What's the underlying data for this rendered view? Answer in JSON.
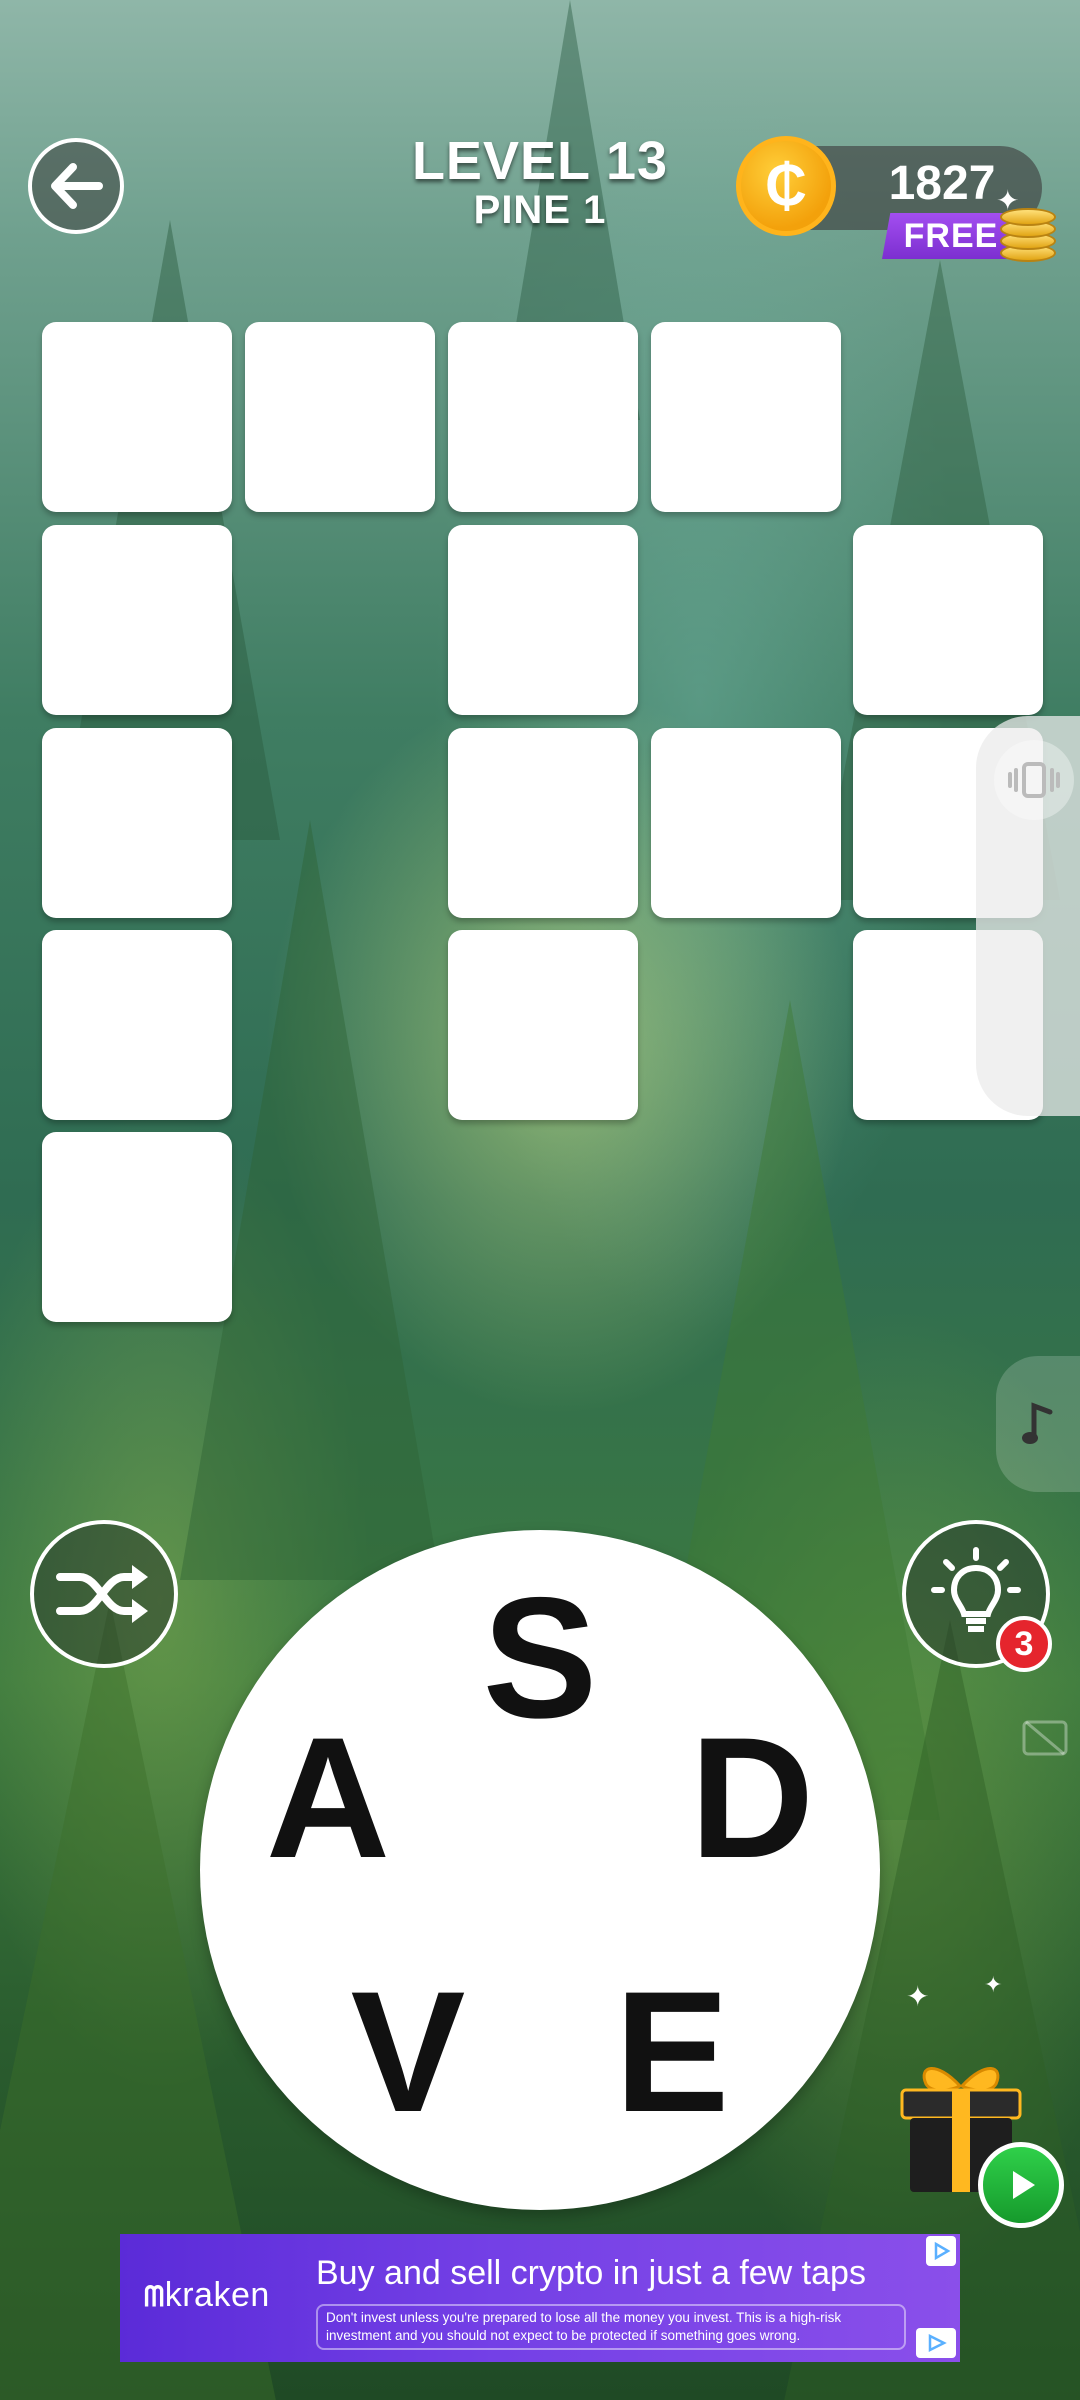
{
  "header": {
    "level_title": "LEVEL 13",
    "level_subtitle": "PINE 1",
    "coins": "1827",
    "free_label": "FREE",
    "coin_symbol": "₵"
  },
  "grid": {
    "tile_color": "#ffffff",
    "tiles_filled": 0,
    "tile_count": 16
  },
  "controls": {
    "hint_count": "3"
  },
  "wheel": {
    "letters": [
      "S",
      "D",
      "E",
      "V",
      "A"
    ]
  },
  "ad": {
    "brand": "kraken",
    "headline": "Buy and sell crypto in just a few taps",
    "disclaimer": "Don't invest unless you're prepared to lose all the money you invest. This is a high-risk investment and you should not expect to be protected if something goes wrong."
  },
  "colors": {
    "coin": "#f3a10b",
    "free_badge": "#8a3ae0",
    "hint_badge": "#e5252d",
    "play": "#1fb83a",
    "ad_bg": "#6a38e0"
  }
}
